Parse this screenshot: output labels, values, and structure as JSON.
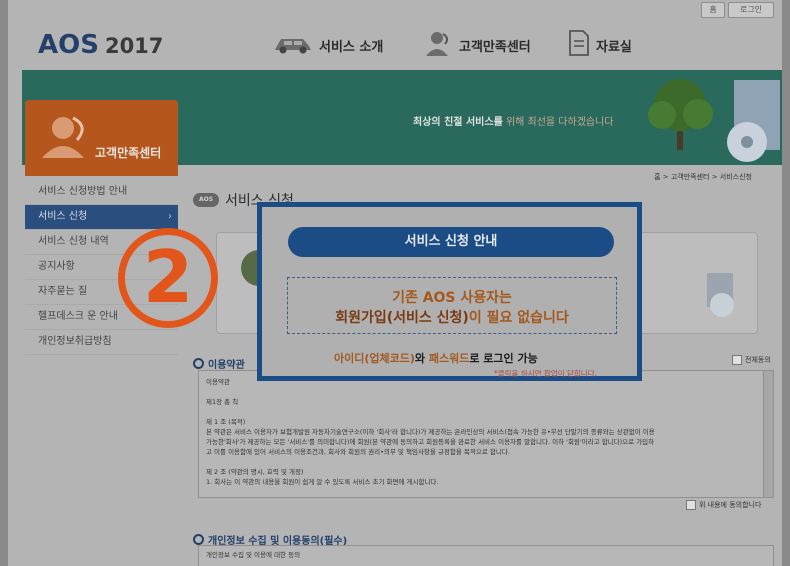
{
  "top_buttons": [
    "홈",
    "로그인"
  ],
  "logo": {
    "brand": "AOS",
    "year": "2017"
  },
  "gnb": [
    {
      "label": "서비스 소개",
      "icon": "car-icon"
    },
    {
      "label": "고객만족센터",
      "icon": "support-person-icon"
    },
    {
      "label": "자료실",
      "icon": "document-icon"
    }
  ],
  "banner": {
    "prefix": "최상의 친절 서비스를",
    "suffix": "위해 최선을 다하겠습니다"
  },
  "sidebar": {
    "title": "고객만족센터",
    "items": [
      {
        "label": "서비스 신청방법 안내"
      },
      {
        "label": "서비스 신청"
      },
      {
        "label": "서비스 신청 내역"
      },
      {
        "label": "공지사항"
      },
      {
        "label": "자주묻는 질"
      },
      {
        "label": "헬프데스크 운 안내"
      },
      {
        "label": "개인정보취급방침"
      }
    ],
    "active_index": 1
  },
  "breadcrumb": "홈 > 고객만족센터 > 서비스신청",
  "page_title": "서비스 신청",
  "sections": {
    "terms_title": "이용약관",
    "all_agree": "전체동의",
    "terms_lines": [
      "이용약관",
      "",
      "제1장 총 칙",
      "",
      "제 1 조 (목적)",
      "본 약관은 서비스 이용자가 보험개발원 자동차기술연구소(이하 '회사'라 합니다)가 제공하는 온라인상의 서비스(접속 가능한 유•무선 단말기의 종류와는 상관없이 이용",
      "가능한'회사'가 제공하는 모든 '서비스'를 의미합니다)에 회원(본 약관에 동의하고 회원등록을 완료한 서비스 이용자를 말합니다. 이하 '회원'이라고 합니다)으로 가입하",
      "고 이를 이용함에 있어 서비스의 이용조건과, 회사와 회원의 권리•의무 및 책임사항을 규정함을 목적으로 합니다.",
      "",
      "제 2 조 (약관의 명시, 효력 및 개정)",
      "1. 회사는 이 약관의 내용을 회원이 쉽게 알 수 있도록 서비스 초기 화면에 게시합니다."
    ],
    "agree_terms": "위 내용에 동의합니다",
    "privacy_title": "개인정보 수집 및 이용동의(필수)",
    "privacy_line": "개인정보 수집 및 이용에 대한 동의"
  },
  "modal": {
    "title": "서비스 신청 안내",
    "line1": "기존 AOS 사용자는",
    "line2_a": "회원가입(서비스 신청)",
    "line2_b": "이 필요 없습니다",
    "login_a": "아이디(업체코드)",
    "login_b": "와 ",
    "login_c": "패스워드",
    "login_d": "로 로그인 가능",
    "note": "*클릭을 하시면 팝업이 닫힙니다."
  },
  "step_marker": "2",
  "colors": {
    "navy": "#1b4c86",
    "orange": "#e2551b",
    "teal": "#2a6a5c"
  }
}
